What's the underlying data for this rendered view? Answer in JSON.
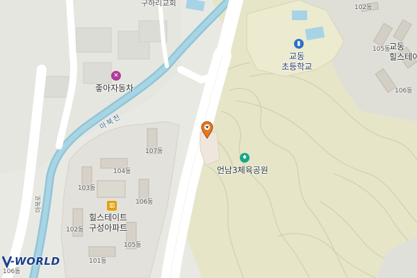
{
  "labels": {
    "church": "구하리교회",
    "school": "교동\n초등학교",
    "school_line1": "교동",
    "school_line2": "초등학교",
    "hills_top_line1": "교동",
    "hills_top_line2": "힐스테이",
    "car_shop": "좋아자동차",
    "stream": "마북천",
    "park": "언남3체육공원",
    "apt_line1": "힐스테이트",
    "apt_line2": "구성아파트",
    "road": "마북로"
  },
  "buildings": {
    "b102_top": "102동",
    "b105_top": "105동",
    "b106_top": "106동",
    "b107": "107동",
    "b104": "104동",
    "b103": "103동",
    "b106": "106동",
    "b102": "102동",
    "b105": "105동",
    "b101": "101동",
    "b106_edge": "106동"
  },
  "logo": {
    "text": "V-WORLD"
  },
  "icons": {
    "school": "building-icon",
    "car_shop": "wrench-icon",
    "park": "sports-icon",
    "apartment": "apartment-icon",
    "marker": "location-pin-icon"
  },
  "colors": {
    "school_icon": "#2f6fc7",
    "car_icon": "#b03a9a",
    "park_icon": "#1aa687",
    "apartment_icon": "#e0a000",
    "marker": "#e8781e"
  }
}
